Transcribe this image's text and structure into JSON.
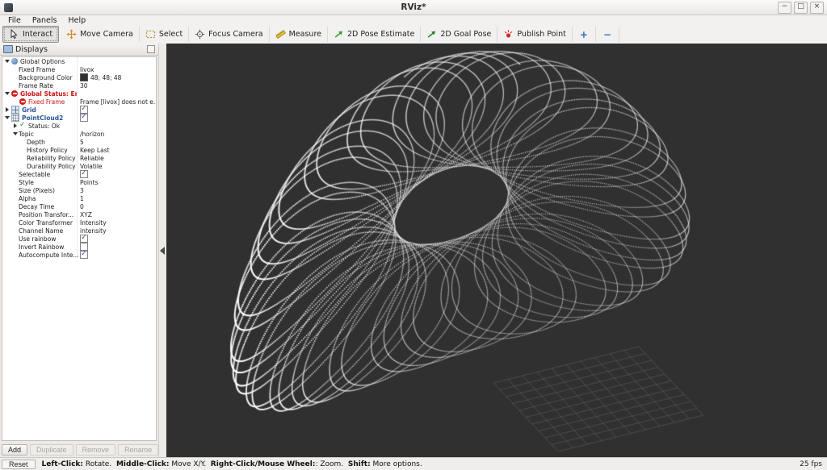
{
  "window": {
    "title": "RViz*",
    "minimize_glyph": "−",
    "maximize_glyph": "□",
    "close_glyph": "×"
  },
  "menu": {
    "items": [
      "File",
      "Panels",
      "Help"
    ]
  },
  "toolbar": {
    "tools": [
      {
        "label": "Interact",
        "icon": "cursor-icon",
        "active": true
      },
      {
        "label": "Move Camera",
        "icon": "move-camera-icon",
        "active": false
      },
      {
        "label": "Select",
        "icon": "select-icon",
        "active": false
      },
      {
        "label": "Focus Camera",
        "icon": "focus-camera-icon",
        "active": false
      },
      {
        "label": "Measure",
        "icon": "measure-icon",
        "active": false
      },
      {
        "label": "2D Pose Estimate",
        "icon": "pose-estimate-icon",
        "active": false
      },
      {
        "label": "2D Goal Pose",
        "icon": "goal-pose-icon",
        "active": false
      },
      {
        "label": "Publish Point",
        "icon": "publish-point-icon",
        "active": false
      }
    ],
    "add_tool_label": "+",
    "remove_tool_label": "−"
  },
  "displays_panel": {
    "title": "Displays",
    "rows": [
      {
        "indent": 0,
        "expander": "open",
        "icon": "globe-icon",
        "name": "Global Options",
        "value": ""
      },
      {
        "indent": 1,
        "name": "Fixed Frame",
        "value": "livox"
      },
      {
        "indent": 1,
        "name": "Background Color",
        "value": "48; 48; 48",
        "swatch": "#303030"
      },
      {
        "indent": 1,
        "name": "Frame Rate",
        "value": "30"
      },
      {
        "indent": 0,
        "expander": "open",
        "icon": "error-icon",
        "name": "Global Status: Error",
        "name_style": "error-b"
      },
      {
        "indent": 1,
        "icon": "error-icon",
        "name": "Fixed Frame",
        "name_style": "error",
        "value": "Frame [livox] does not e..."
      },
      {
        "indent": 0,
        "expander": "closed",
        "icon": "grid-icon",
        "name": "Grid",
        "name_style": "display",
        "value_type": "check",
        "checked": true
      },
      {
        "indent": 0,
        "expander": "open",
        "icon": "pointcloud-icon",
        "name": "PointCloud2",
        "name_style": "display",
        "value_type": "check",
        "checked": true
      },
      {
        "indent": 1,
        "expander": "closed",
        "icon": "ok-icon",
        "name": "Status: Ok"
      },
      {
        "indent": 1,
        "expander": "open",
        "name": "Topic",
        "value": "/horizon"
      },
      {
        "indent": 2,
        "name": "Depth",
        "value": "5"
      },
      {
        "indent": 2,
        "name": "History Policy",
        "value": "Keep Last"
      },
      {
        "indent": 2,
        "name": "Reliability Policy",
        "value": "Reliable"
      },
      {
        "indent": 2,
        "name": "Durability Policy",
        "value": "Volatile"
      },
      {
        "indent": 1,
        "name": "Selectable",
        "value_type": "check",
        "checked": true
      },
      {
        "indent": 1,
        "name": "Style",
        "value": "Points"
      },
      {
        "indent": 1,
        "name": "Size (Pixels)",
        "value": "3"
      },
      {
        "indent": 1,
        "name": "Alpha",
        "value": "1"
      },
      {
        "indent": 1,
        "name": "Decay Time",
        "value": "0"
      },
      {
        "indent": 1,
        "name": "Position Transfor...",
        "value": "XYZ"
      },
      {
        "indent": 1,
        "name": "Color Transformer",
        "value": "Intensity"
      },
      {
        "indent": 1,
        "name": "Channel Name",
        "value": "intensity"
      },
      {
        "indent": 1,
        "name": "Use rainbow",
        "value_type": "check",
        "checked": true
      },
      {
        "indent": 1,
        "name": "Invert Rainbow",
        "value_type": "check",
        "checked": false
      },
      {
        "indent": 1,
        "name": "Autocompute Inte...",
        "value_type": "check",
        "checked": true
      }
    ],
    "buttons": [
      {
        "label": "Add",
        "enabled": true
      },
      {
        "label": "Duplicate",
        "enabled": false
      },
      {
        "label": "Remove",
        "enabled": false
      },
      {
        "label": "Rename",
        "enabled": false
      }
    ]
  },
  "viewport": {
    "background_color": "#303030",
    "point_color": "#ffffff",
    "grid_color": "#747a74"
  },
  "statusbar": {
    "reset_label": "Reset",
    "hint_segments": [
      {
        "text": "Left-Click:",
        "bold": true
      },
      {
        "text": " Rotate.  ",
        "bold": false
      },
      {
        "text": "Middle-Click:",
        "bold": true
      },
      {
        "text": " Move X/Y.  ",
        "bold": false
      },
      {
        "text": "Right-Click/Mouse Wheel:",
        "bold": true
      },
      {
        "text": ": Zoom.  ",
        "bold": false
      },
      {
        "text": "Shift:",
        "bold": true
      },
      {
        "text": " More options.",
        "bold": false
      }
    ],
    "fps": "25 fps"
  }
}
